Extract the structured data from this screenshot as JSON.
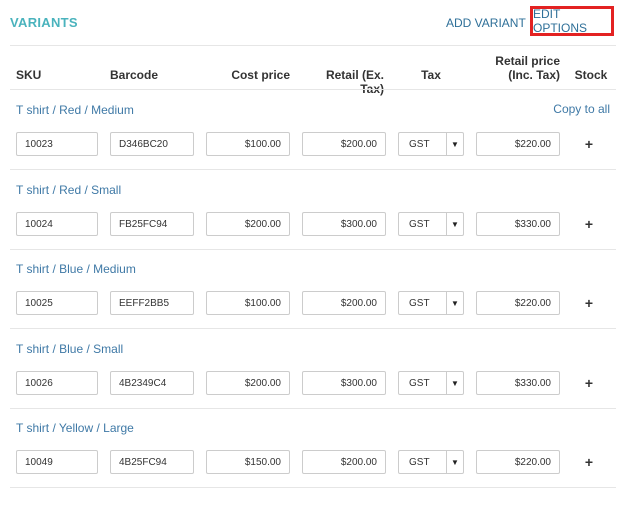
{
  "header": {
    "title": "VARIANTS",
    "add_variant": "ADD VARIANT",
    "edit_options": "EDIT OPTIONS"
  },
  "columns": {
    "sku": "SKU",
    "barcode": "Barcode",
    "cost_price": "Cost price",
    "retail_ex": "Retail (Ex. Tax)",
    "tax": "Tax",
    "retail_inc_line1": "Retail price",
    "retail_inc_line2": "(Inc. Tax)",
    "stock": "Stock"
  },
  "copy_to_all": "Copy to all",
  "stock_icon": "plus-icon",
  "tax_icon": "dropdown-caret-icon",
  "colors": {
    "accent": "#4ab3bd",
    "link": "#3f79a6",
    "highlight": "#e32222"
  },
  "variants": [
    {
      "name": "T shirt / Red / Medium",
      "sku": "10023",
      "barcode": "D346BC20",
      "cost": "$100.00",
      "retail_ex": "$200.00",
      "tax": "GST",
      "retail_inc": "$220.00"
    },
    {
      "name": "T shirt / Red / Small",
      "sku": "10024",
      "barcode": "FB25FC94",
      "cost": "$200.00",
      "retail_ex": "$300.00",
      "tax": "GST",
      "retail_inc": "$330.00"
    },
    {
      "name": "T shirt / Blue / Medium",
      "sku": "10025",
      "barcode": "EEFF2BB5",
      "cost": "$100.00",
      "retail_ex": "$200.00",
      "tax": "GST",
      "retail_inc": "$220.00"
    },
    {
      "name": "T shirt / Blue / Small",
      "sku": "10026",
      "barcode": "4B2349C4",
      "cost": "$200.00",
      "retail_ex": "$300.00",
      "tax": "GST",
      "retail_inc": "$330.00"
    },
    {
      "name": "T shirt / Yellow / Large",
      "sku": "10049",
      "barcode": "4B25FC94",
      "cost": "$150.00",
      "retail_ex": "$200.00",
      "tax": "GST",
      "retail_inc": "$220.00"
    }
  ]
}
